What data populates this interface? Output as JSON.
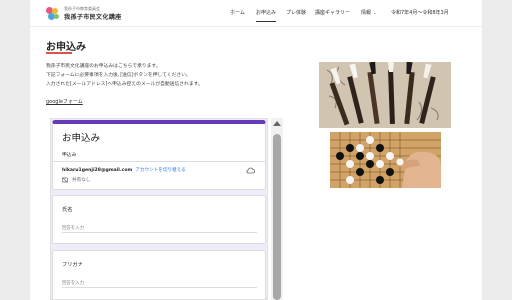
{
  "header": {
    "logo_sub": "我孫子市教育委員会",
    "logo_title": "我孫子市民文化講座",
    "nav": [
      {
        "label": "ホーム"
      },
      {
        "label": "お申込み"
      },
      {
        "label": "プレ体験"
      },
      {
        "label": "講座ギャラリー"
      },
      {
        "label": "情報"
      },
      {
        "label": "令和7年4月～令和8年3月"
      }
    ],
    "active_index": 1
  },
  "main": {
    "title": "お申込み",
    "paragraphs": [
      "我孫子市民文化講座のお申込みはこちらで承ります。",
      "下記フォームに必要事項を入力後､[送信]ボタンを押してください。",
      "入力された[メールアドレス]へ申込み控えのメールが自動送信されます。"
    ],
    "google_form_link": "googleフォーム"
  },
  "form": {
    "title": "お申込み",
    "description": "申込み",
    "email": "hikaru1genji28@gmail.com",
    "switch_account": "アカウントを切り替える",
    "share_status": "共有なし",
    "questions": [
      {
        "label": "氏名",
        "placeholder": "回答を入力"
      },
      {
        "label": "フリガナ",
        "placeholder": "回答を入力"
      }
    ]
  },
  "images": [
    {
      "name": "calligraphy-brushes-image"
    },
    {
      "name": "go-game-image"
    }
  ],
  "colors": {
    "accent_red": "#d9534f",
    "form_purple": "#673ab7",
    "form_bg": "#f0ebf8",
    "link_blue": "#1a73e8"
  }
}
